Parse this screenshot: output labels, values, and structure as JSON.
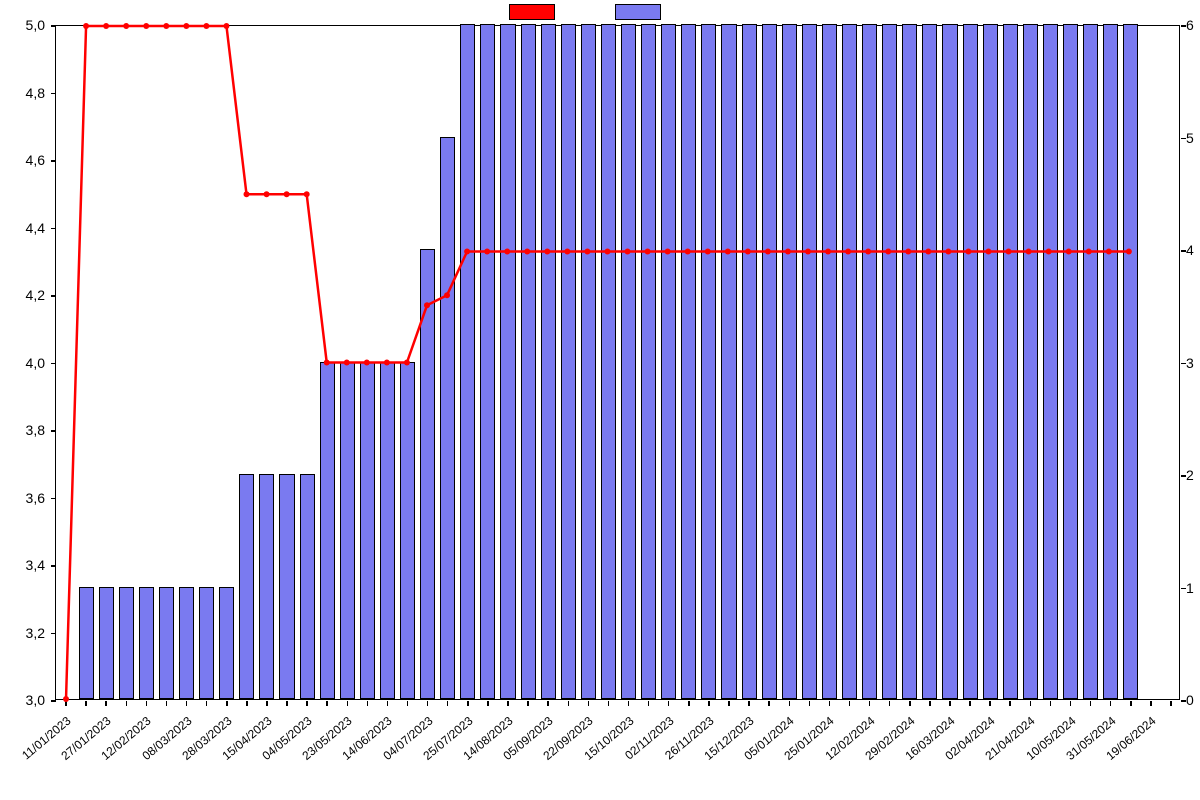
{
  "chart_data": {
    "type": "bar+line",
    "categories": [
      "11/01/2023",
      "",
      "27/01/2023",
      "",
      "12/02/2023",
      "",
      "08/03/2023",
      "",
      "28/03/2023",
      "",
      "15/04/2023",
      "",
      "04/05/2023",
      "",
      "23/05/2023",
      "",
      "14/06/2023",
      "",
      "04/07/2023",
      "",
      "25/07/2023",
      "",
      "14/08/2023",
      "",
      "05/09/2023",
      "",
      "22/09/2023",
      "",
      "15/10/2023",
      "",
      "02/11/2023",
      "",
      "26/11/2023",
      "",
      "15/12/2023",
      "",
      "05/01/2024",
      "",
      "25/01/2024",
      "",
      "12/02/2024",
      "",
      "29/02/2024",
      "",
      "16/03/2024",
      "",
      "02/04/2024",
      "",
      "21/04/2024",
      "",
      "10/05/2024",
      "",
      "31/05/2024",
      "",
      "19/06/2024",
      ""
    ],
    "series": [
      {
        "name": "blue",
        "axis": "right",
        "style": "bar",
        "values": [
          0,
          1,
          1,
          1,
          1,
          1,
          1,
          1,
          1,
          2,
          2,
          2,
          2,
          3,
          3,
          3,
          3,
          3,
          4,
          5,
          6,
          6,
          6,
          6,
          6,
          6,
          6,
          6,
          6,
          6,
          6,
          6,
          6,
          6,
          6,
          6,
          6,
          6,
          6,
          6,
          6,
          6,
          6,
          6,
          6,
          6,
          6,
          6,
          6,
          6,
          6,
          6,
          6,
          6
        ]
      },
      {
        "name": "red",
        "axis": "left",
        "style": "line",
        "values": [
          3.0,
          5.0,
          5.0,
          5.0,
          5.0,
          5.0,
          5.0,
          5.0,
          5.0,
          4.5,
          4.5,
          4.5,
          4.5,
          4.0,
          4.0,
          4.0,
          4.0,
          4.0,
          4.17,
          4.2,
          4.33,
          4.33,
          4.33,
          4.33,
          4.33,
          4.33,
          4.33,
          4.33,
          4.33,
          4.33,
          4.33,
          4.33,
          4.33,
          4.33,
          4.33,
          4.33,
          4.33,
          4.33,
          4.33,
          4.33,
          4.33,
          4.33,
          4.33,
          4.33,
          4.33,
          4.33,
          4.33,
          4.33,
          4.33,
          4.33,
          4.33,
          4.33,
          4.33,
          4.33
        ]
      }
    ],
    "left_axis": {
      "min": 3.0,
      "max": 5.0,
      "ticks": [
        3.0,
        3.2,
        3.4,
        3.6,
        3.8,
        4.0,
        4.2,
        4.4,
        4.6,
        4.8,
        5.0
      ],
      "tick_labels": [
        "3,0",
        "3,2",
        "3,4",
        "3,6",
        "3,8",
        "4,0",
        "4,2",
        "4,4",
        "4,6",
        "4,8",
        "5,0"
      ]
    },
    "right_axis": {
      "min": 0,
      "max": 6,
      "ticks": [
        0,
        1,
        2,
        3,
        4,
        5,
        6
      ]
    },
    "colors": {
      "red": "#ff0000",
      "blue": "#7a7af0"
    },
    "xtick_label_angle_deg": -40,
    "legend": {
      "red_label": "",
      "blue_label": ""
    }
  }
}
